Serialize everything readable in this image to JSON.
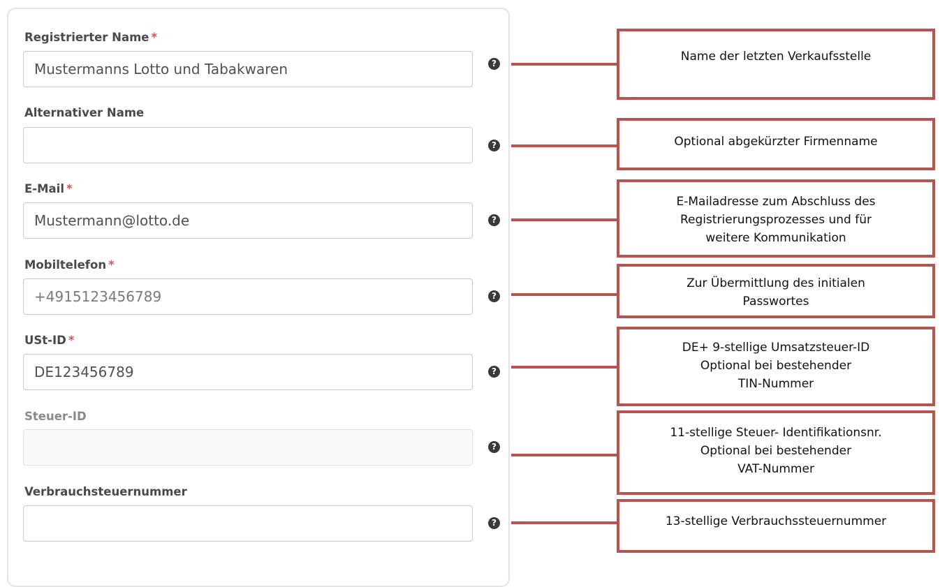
{
  "fields": [
    {
      "label": "Registrierter Name",
      "required": "*",
      "value": "Mustermanns Lotto und Tabakwaren"
    },
    {
      "label": "Alternativer Name",
      "required": "",
      "value": ""
    },
    {
      "label": "E-Mail",
      "required": "*",
      "value": "Mustermann@lotto.de"
    },
    {
      "label": "Mobiltelefon",
      "required": "*",
      "value": "+4915123456789"
    },
    {
      "label": "USt-ID",
      "required": "*",
      "value": "DE123456789"
    },
    {
      "label": "Steuer-ID",
      "required": "",
      "value": ""
    },
    {
      "label": "Verbrauchsteuernummer",
      "required": "",
      "value": ""
    }
  ],
  "help_icon": "question-circle-icon",
  "help_glyph": "?",
  "callouts": [
    {
      "lines": [
        "Name der letzten Verkaufsstelle"
      ]
    },
    {
      "lines": [
        "Optional abgekürzter Firmenname"
      ]
    },
    {
      "lines": [
        "E-Mailadresse zum Abschluss des",
        "Registrierungsprozesses  und für",
        "weitere Kommunikation"
      ]
    },
    {
      "lines": [
        "Zur Übermittlung des initialen",
        "Passwortes"
      ]
    },
    {
      "lines": [
        "DE+ 9-stellige Umsatzsteuer-ID",
        "Optional bei bestehender",
        "TIN-Nummer"
      ]
    },
    {
      "lines": [
        "11-stellige Steuer- Identifikationsnr.",
        "Optional bei bestehender",
        "VAT-Nummer"
      ]
    },
    {
      "lines": [
        "13-stellige Verbrauchssteuernummer"
      ]
    }
  ],
  "colors": {
    "required": "#d9534f",
    "callout_border": "#b85450",
    "help_icon": "#3a3a3a"
  }
}
